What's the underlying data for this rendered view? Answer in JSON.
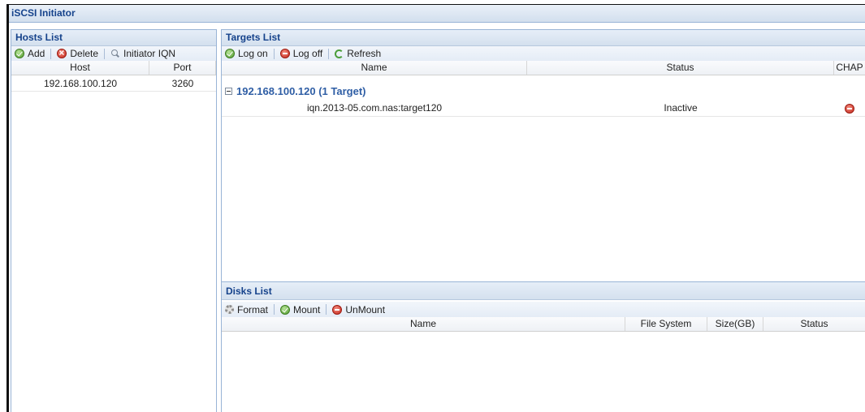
{
  "window": {
    "title": "iSCSI Initiator"
  },
  "hosts": {
    "title": "Hosts List",
    "toolbar": {
      "add": "Add",
      "delete": "Delete",
      "initiator_iqn": "Initiator IQN"
    },
    "columns": {
      "host": "Host",
      "port": "Port"
    },
    "rows": [
      {
        "host": "192.168.100.120",
        "port": "3260"
      }
    ]
  },
  "targets": {
    "title": "Targets List",
    "toolbar": {
      "log_on": "Log on",
      "log_off": "Log off",
      "refresh": "Refresh"
    },
    "columns": {
      "name": "Name",
      "status": "Status",
      "chap": "CHAP"
    },
    "groups": [
      {
        "label": "192.168.100.120 (1 Target)",
        "rows": [
          {
            "name": "iqn.2013-05.com.nas:target120",
            "status": "Inactive",
            "chap_icon": "red-minus-icon"
          }
        ]
      }
    ]
  },
  "disks": {
    "title": "Disks List",
    "toolbar": {
      "format": "Format",
      "mount": "Mount",
      "unmount": "UnMount"
    },
    "columns": {
      "name": "Name",
      "file_system": "File System",
      "size": "Size(GB)",
      "status": "Status"
    },
    "rows": []
  },
  "colors": {
    "header_text": "#15428b",
    "group_text": "#2f5ea5",
    "border": "#99b4d6"
  }
}
